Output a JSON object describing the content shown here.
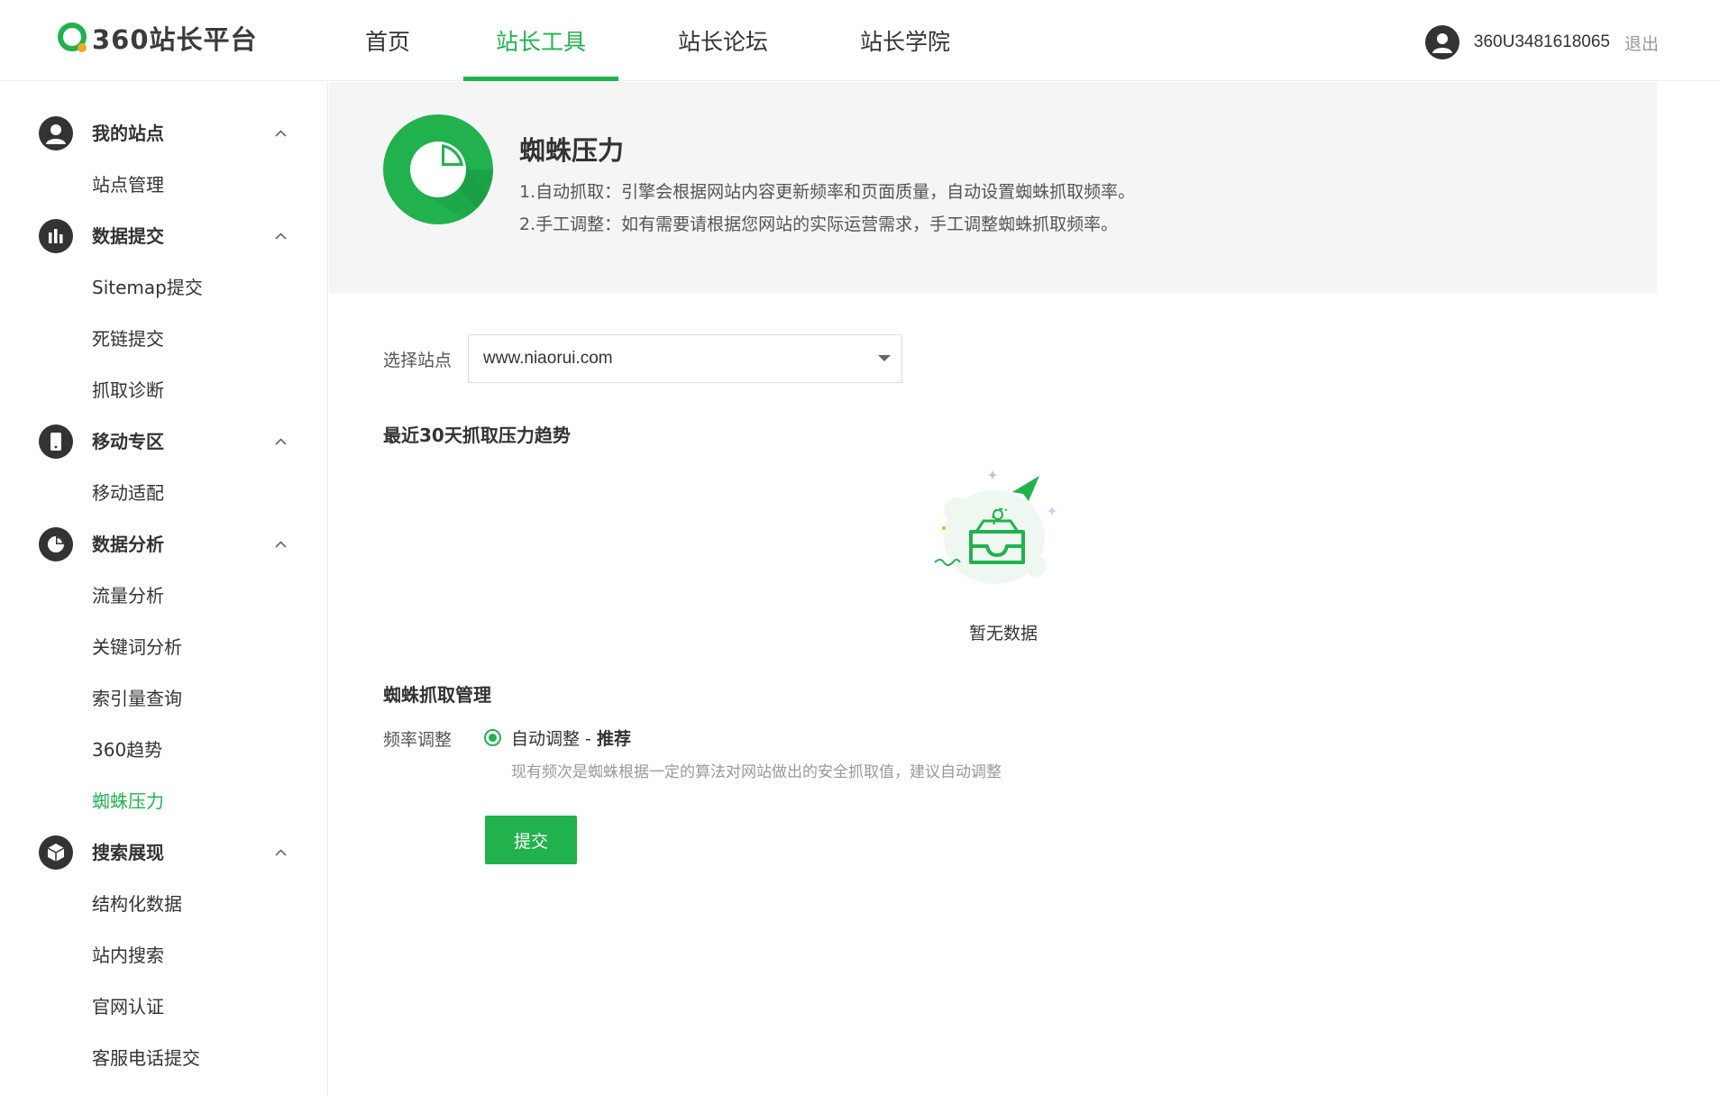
{
  "brand": {
    "logo_text": "360站长平台",
    "accent": "#21b24e",
    "logo_ring": "#21b24e",
    "logo_dot": "#f5a623"
  },
  "nav": {
    "items": [
      {
        "label": "首页",
        "active": false
      },
      {
        "label": "站长工具",
        "active": true
      },
      {
        "label": "站长论坛",
        "active": false
      },
      {
        "label": "站长学院",
        "active": false
      }
    ]
  },
  "user": {
    "name": "360U3481618065",
    "logout": "退出",
    "avatar_icon": "user-icon"
  },
  "sidebar": {
    "groups": [
      {
        "label": "我的站点",
        "icon": "user-icon",
        "expanded": true,
        "items": [
          "站点管理"
        ]
      },
      {
        "label": "数据提交",
        "icon": "bar-chart-icon",
        "expanded": true,
        "items": [
          "Sitemap提交",
          "死链提交",
          "抓取诊断"
        ]
      },
      {
        "label": "移动专区",
        "icon": "mobile-icon",
        "expanded": true,
        "items": [
          "移动适配"
        ]
      },
      {
        "label": "数据分析",
        "icon": "pie-chart-icon",
        "expanded": true,
        "items": [
          "流量分析",
          "关键词分析",
          "索引量查询",
          "360趋势",
          "蜘蛛压力"
        ]
      },
      {
        "label": "搜索展现",
        "icon": "cube-icon",
        "expanded": true,
        "items": [
          "结构化数据",
          "站内搜索",
          "官网认证",
          "客服电话提交"
        ]
      }
    ],
    "active_item": "蜘蛛压力"
  },
  "banner": {
    "icon": "pie-chart-icon",
    "title": "蜘蛛压力",
    "desc1": "1.自动抓取：引擎会根据网站内容更新频率和页面质量，自动设置蜘蛛抓取频率。",
    "desc2": "2.手工调整：如有需要请根据您网站的实际运营需求，手工调整蜘蛛抓取频率。"
  },
  "site_select": {
    "label": "选择站点",
    "value": "www.niaorui.com"
  },
  "trend": {
    "title": "最近30天抓取压力趋势",
    "empty_text": "暂无数据",
    "empty_icon": "empty-inbox-icon"
  },
  "management": {
    "title": "蜘蛛抓取管理",
    "freq_label": "频率调整",
    "option_label": "自动调整 - ",
    "option_emphasis": "推荐",
    "hint": "现有频次是蜘蛛根据一定的算法对网站做出的安全抓取值，建议自动调整",
    "submit_label": "提交"
  }
}
